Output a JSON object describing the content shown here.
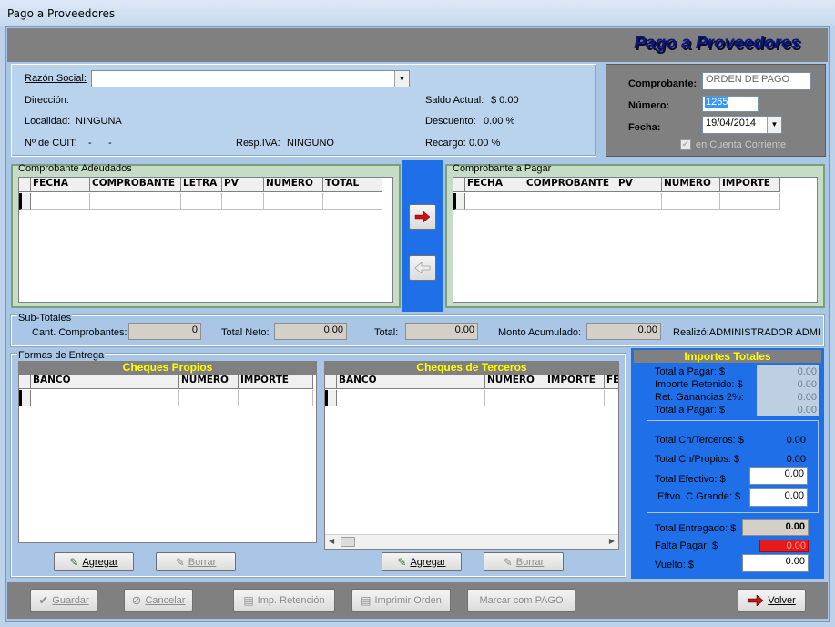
{
  "window": {
    "title": "Pago a Proveedores"
  },
  "header": {
    "title": "Pago a Proveedores"
  },
  "cliente": {
    "razon_social_label": "Razón Social:",
    "razon_social_value": "",
    "direccion_label": "Dirección:",
    "localidad_label": "Localidad:",
    "localidad_value": "NINGUNA",
    "cuit_label": "Nº de CUIT:",
    "cuit_value": "-      -",
    "resp_iva_label": "Resp.IVA:",
    "resp_iva_value": "NINGUNO",
    "saldo_label": "Saldo Actual:",
    "saldo_value": "$ 0.00",
    "descuento_label": "Descuento:",
    "descuento_value": "0.00 %",
    "recargo_label": "Recargo:",
    "recargo_value": "0.00 %"
  },
  "comprobante": {
    "comprobante_label": "Comprobante:",
    "comprobante_value": "ORDEN DE PAGO",
    "numero_label": "Número:",
    "numero_value": "1265",
    "fecha_label": "Fecha:",
    "fecha_value": "19/04/2014",
    "cuenta_corriente_label": "en Cuenta Corriente",
    "cuenta_corriente_checked": true
  },
  "adeudados": {
    "title": "Comprobante Adeudados",
    "columns": [
      "FECHA",
      "COMPROBANTE",
      "LETRA",
      "PV",
      "NUMERO",
      "TOTAL"
    ]
  },
  "a_pagar": {
    "title": "Comprobante a Pagar",
    "columns": [
      "FECHA",
      "COMPROBANTE",
      "PV",
      "NUMERO",
      "IMPORTE"
    ]
  },
  "subtotales": {
    "title": "Sub-Totales",
    "cant_label": "Cant. Comprobantes:",
    "cant_value": "0",
    "neto_label": "Total Neto:",
    "neto_value": "0.00",
    "total_label": "Total:",
    "total_value": "0.00",
    "monto_label": "Monto Acumulado:",
    "monto_value": "0.00",
    "realizo": "Realizó:ADMINISTRADOR ADMI"
  },
  "entrega": {
    "title": "Formas de Entrega",
    "propios_title": "Cheques Propios",
    "propios_columns": [
      "BANCO",
      "NUMERO",
      "IMPORTE"
    ],
    "terceros_title": "Cheques de Terceros",
    "terceros_columns": [
      "BANCO",
      "NUMERO",
      "IMPORTE",
      "FE"
    ],
    "agregar_label": "Agregar",
    "borrar_label": "Borrar"
  },
  "importes": {
    "title": "Importes Totales",
    "total_pagar_label": "Total a Pagar: $",
    "total_pagar_value": "0.00",
    "retenido_label": "Importe Retenido: $",
    "retenido_value": "0.00",
    "ganancias_label": "Ret. Ganancias 2%:",
    "ganancias_value": "0.00",
    "total_pagar2_label": "Total a Pagar: $",
    "total_pagar2_value": "0.00",
    "ch_terceros_label": "Total Ch/Terceros: $",
    "ch_terceros_value": "0.00",
    "ch_propios_label": "Total Ch/Propios: $",
    "ch_propios_value": "0.00",
    "efectivo_label": "Total Efectivo: $",
    "efectivo_value": "0.00",
    "cgrande_label": "Eftvo. C.Grande: $",
    "cgrande_value": "0.00",
    "entregado_label": "Total Entregado: $",
    "entregado_value": "0.00",
    "falta_label": "Falta Pagar: $",
    "falta_value": "0.00",
    "vuelto_label": "Vuelto: $",
    "vuelto_value": "0.00"
  },
  "footer": {
    "guardar": "Guardar",
    "cancelar": "Cancelar",
    "retencion": "Imp. Retención",
    "imprimir": "Imprimir Orden",
    "marcar": "Marcar com PAGO",
    "volver": "Volver"
  },
  "colors": {
    "header_title": "#0a1880",
    "caption_yellow": "#ffff00",
    "falta_red": "#e51a1a",
    "blue_bar": "#1e6fe8"
  }
}
